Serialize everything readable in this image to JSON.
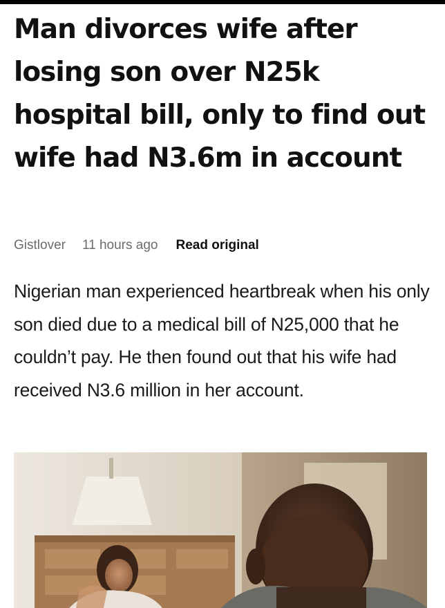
{
  "article": {
    "headline": "Man divorces wife after losing son over N25k hospital bill, only to find out wife had N3.6m in account",
    "source": "Gistlover",
    "time": "11 hours ago",
    "read_original": "Read original",
    "summary": "Nigerian man experienced heartbreak when his only son died due to a medical bill of N25,000 that he couldn’t pay. He then found out that his wife had received N3.6 million in her account."
  }
}
